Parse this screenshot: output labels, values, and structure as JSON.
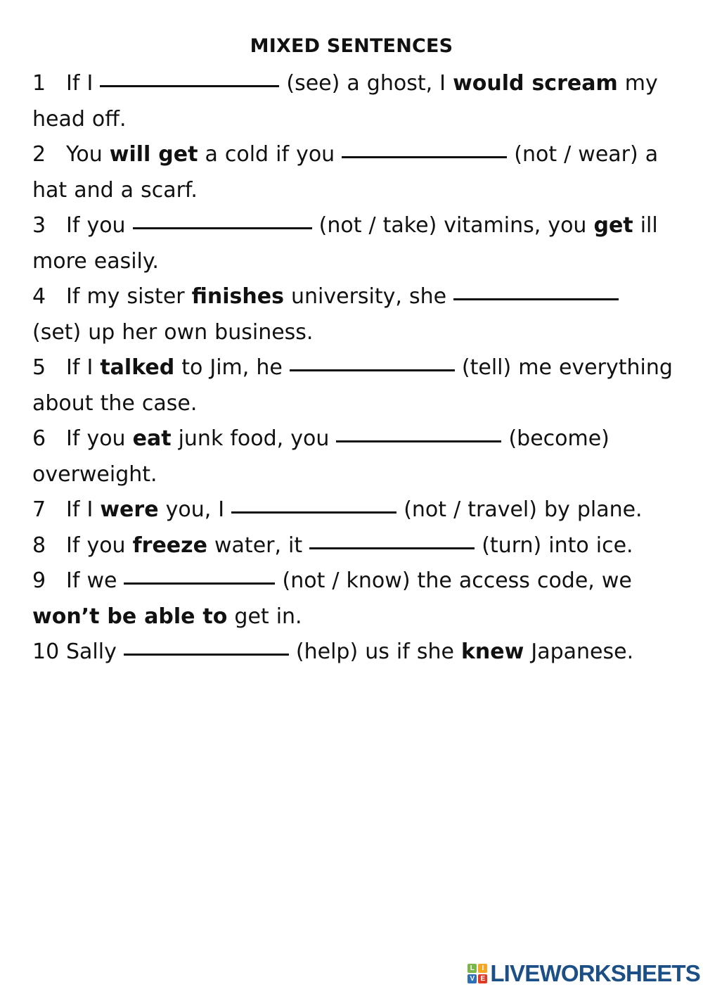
{
  "worksheet": {
    "title": "MIXED SENTENCES",
    "items": [
      {
        "number": "1",
        "parts": [
          {
            "type": "text",
            "text": "If I "
          },
          {
            "type": "blank",
            "size": "lg"
          },
          {
            "type": "text",
            "text": " (see) a ghost, I "
          },
          {
            "type": "bold",
            "text": "would scream"
          },
          {
            "type": "text",
            "text": " my head off."
          }
        ],
        "plain": "1 If I ____ (see) a ghost, I would scream my head off."
      },
      {
        "number": "2",
        "parts": [
          {
            "type": "text",
            "text": "You "
          },
          {
            "type": "bold",
            "text": "will get"
          },
          {
            "type": "text",
            "text": " a cold if you "
          },
          {
            "type": "blank",
            "size": "md"
          },
          {
            "type": "text",
            "text": " (not / wear) a hat and a scarf."
          }
        ],
        "plain": "2 You will get a cold if you ____ (not / wear) a hat and a scarf."
      },
      {
        "number": "3",
        "parts": [
          {
            "type": "text",
            "text": "If you "
          },
          {
            "type": "blank",
            "size": "lg"
          },
          {
            "type": "text",
            "text": " (not / take) vitamins, you "
          },
          {
            "type": "bold",
            "text": "get"
          },
          {
            "type": "text",
            "text": " ill more easily."
          }
        ],
        "plain": "3 If you ____ (not / take) vitamins, you get ill more easily."
      },
      {
        "number": "4",
        "parts": [
          {
            "type": "text",
            "text": "If my sister "
          },
          {
            "type": "bold",
            "text": "finishes"
          },
          {
            "type": "text",
            "text": " university, she "
          },
          {
            "type": "blank",
            "size": "md"
          },
          {
            "type": "text",
            "text": " (set) up her own business."
          }
        ],
        "plain": "4 If my sister finishes university, she ____ (set) up her own business."
      },
      {
        "number": "5",
        "parts": [
          {
            "type": "text",
            "text": "If I "
          },
          {
            "type": "bold",
            "text": "talked"
          },
          {
            "type": "text",
            "text": " to Jim, he "
          },
          {
            "type": "blank",
            "size": "md"
          },
          {
            "type": "text",
            "text": " (tell) me everything about the case."
          }
        ],
        "plain": "5 If I talked to Jim, he ____ (tell) me everything about the case."
      },
      {
        "number": "6",
        "parts": [
          {
            "type": "text",
            "text": "If you "
          },
          {
            "type": "bold",
            "text": "eat"
          },
          {
            "type": "text",
            "text": " junk food, you "
          },
          {
            "type": "blank",
            "size": "md"
          },
          {
            "type": "text",
            "text": " (become) overweight."
          }
        ],
        "plain": "6 If you eat junk food, you ____ (become) overweight."
      },
      {
        "number": "7",
        "parts": [
          {
            "type": "text",
            "text": "If I "
          },
          {
            "type": "bold",
            "text": "were"
          },
          {
            "type": "text",
            "text": " you, I "
          },
          {
            "type": "blank",
            "size": "md"
          },
          {
            "type": "text",
            "text": " (not / travel) by plane."
          }
        ],
        "plain": "7 If I were you, I ____ (not / travel) by plane."
      },
      {
        "number": "8",
        "parts": [
          {
            "type": "text",
            "text": "If you "
          },
          {
            "type": "bold",
            "text": "freeze"
          },
          {
            "type": "text",
            "text": " water, it "
          },
          {
            "type": "blank",
            "size": "md"
          },
          {
            "type": "text",
            "text": " (turn) into ice."
          }
        ],
        "plain": "8 If you freeze water, it ____ (turn) into ice."
      },
      {
        "number": "9",
        "parts": [
          {
            "type": "text",
            "text": "If we "
          },
          {
            "type": "blank",
            "size": "sm"
          },
          {
            "type": "text",
            "text": " (not / know) the access code, we "
          },
          {
            "type": "bold",
            "text": "won’t be able to"
          },
          {
            "type": "text",
            "text": " get in."
          }
        ],
        "plain": "9 If we ____ (not / know) the access code, we won’t be able to get in."
      },
      {
        "number": "10",
        "parts": [
          {
            "type": "text",
            "text": "Sally "
          },
          {
            "type": "blank",
            "size": "md"
          },
          {
            "type": "text",
            "text": " (help) us if she "
          },
          {
            "type": "bold",
            "text": "knew"
          },
          {
            "type": "text",
            "text": " Japanese."
          }
        ],
        "plain": "10 Sally ____ (help) us if she knew Japanese."
      }
    ]
  },
  "footer": {
    "logo": {
      "wordmark": "LIVEWORKSHEETS",
      "wordmark_color": "#1b4f85",
      "tiles": [
        {
          "letter": "L",
          "color": "#7ab648"
        },
        {
          "letter": "I",
          "color": "#f5a623"
        },
        {
          "letter": "V",
          "color": "#2e6fb7"
        },
        {
          "letter": "E",
          "color": "#e03a27"
        }
      ]
    }
  }
}
